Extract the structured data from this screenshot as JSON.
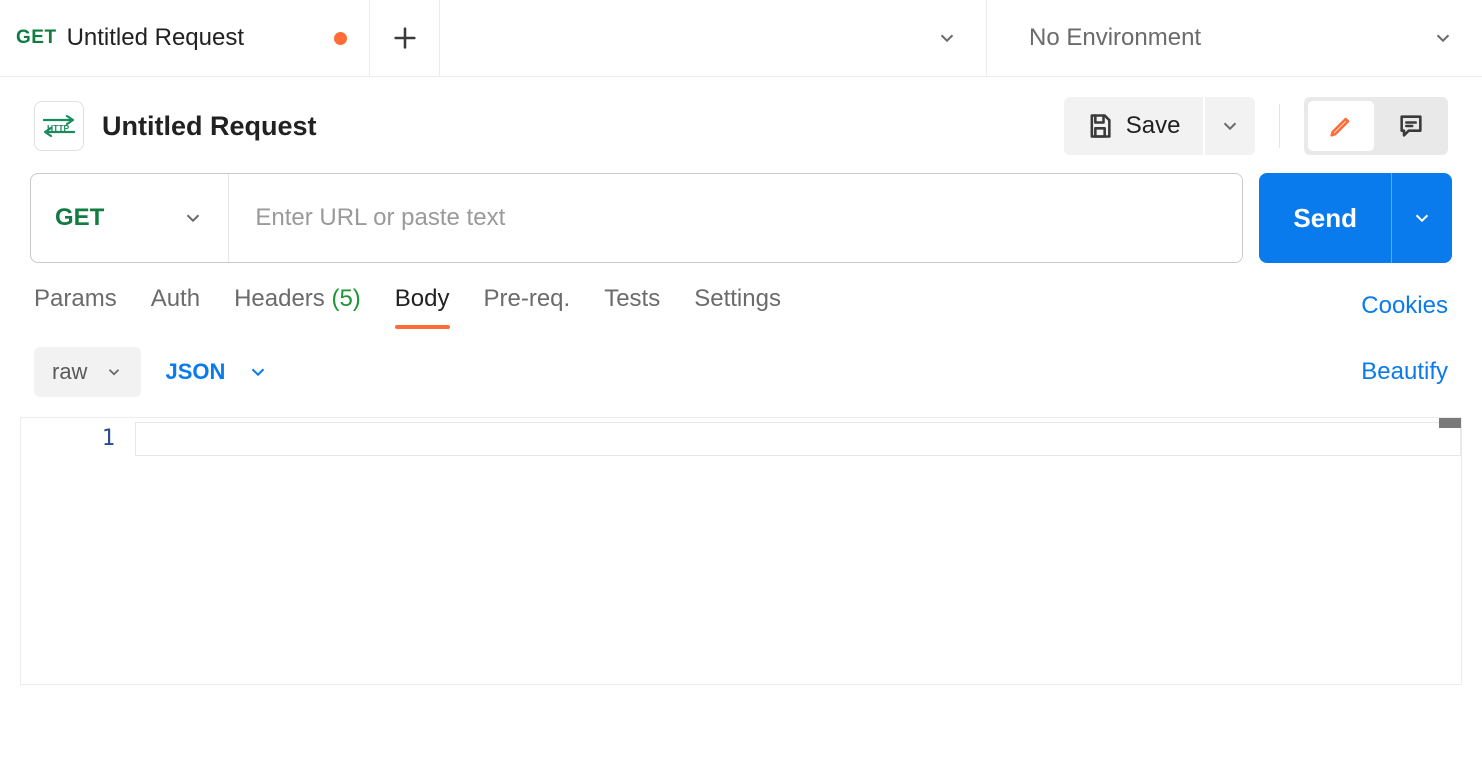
{
  "tabs": {
    "active": {
      "method": "GET",
      "title": "Untitled Request",
      "dirty": true
    }
  },
  "environment": {
    "label": "No Environment"
  },
  "request": {
    "name": "Untitled Request",
    "method": "GET",
    "url": "",
    "url_placeholder": "Enter URL or paste text"
  },
  "toolbar": {
    "save_label": "Save",
    "send_label": "Send"
  },
  "subtabs": [
    {
      "label": "Params",
      "active": false
    },
    {
      "label": "Auth",
      "active": false
    },
    {
      "label": "Headers",
      "count": "(5)",
      "active": false
    },
    {
      "label": "Body",
      "active": true
    },
    {
      "label": "Pre-req.",
      "active": false
    },
    {
      "label": "Tests",
      "active": false
    },
    {
      "label": "Settings",
      "active": false
    }
  ],
  "links": {
    "cookies": "Cookies",
    "beautify": "Beautify"
  },
  "body": {
    "mode": "raw",
    "language": "JSON",
    "gutter_line": "1"
  }
}
